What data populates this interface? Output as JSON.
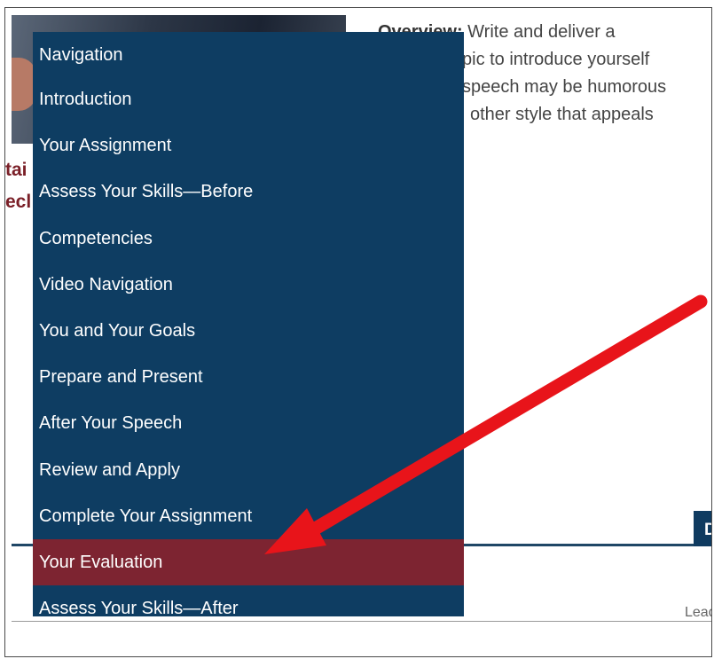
{
  "overview": {
    "label": "Overview:",
    "line1": " Write and deliver a",
    "line2": "pic to introduce yourself",
    "line3": "speech may be humorous",
    "line4": "other style that appeals"
  },
  "left_fragment": {
    "line1": "tai",
    "line2": "ecl"
  },
  "menu": {
    "items": [
      {
        "label": "Navigation"
      },
      {
        "label": "Introduction"
      },
      {
        "label": "Your Assignment"
      },
      {
        "label": "Assess Your Skills—Before"
      },
      {
        "label": "Competencies"
      },
      {
        "label": "Video Navigation"
      },
      {
        "label": "You and Your Goals"
      },
      {
        "label": "Prepare and Present"
      },
      {
        "label": "After Your Speech"
      },
      {
        "label": "Review and Apply"
      },
      {
        "label": "Complete Your Assignment"
      },
      {
        "label": "Your Evaluation"
      },
      {
        "label": "Assess Your Skills—After"
      }
    ],
    "active_index": 11,
    "background_color": "#0e3d62",
    "active_color": "#7d2431"
  },
  "tab_fragment": "D",
  "footer_fragment": "Lead",
  "annotation": {
    "arrow_color": "#e8141a"
  }
}
